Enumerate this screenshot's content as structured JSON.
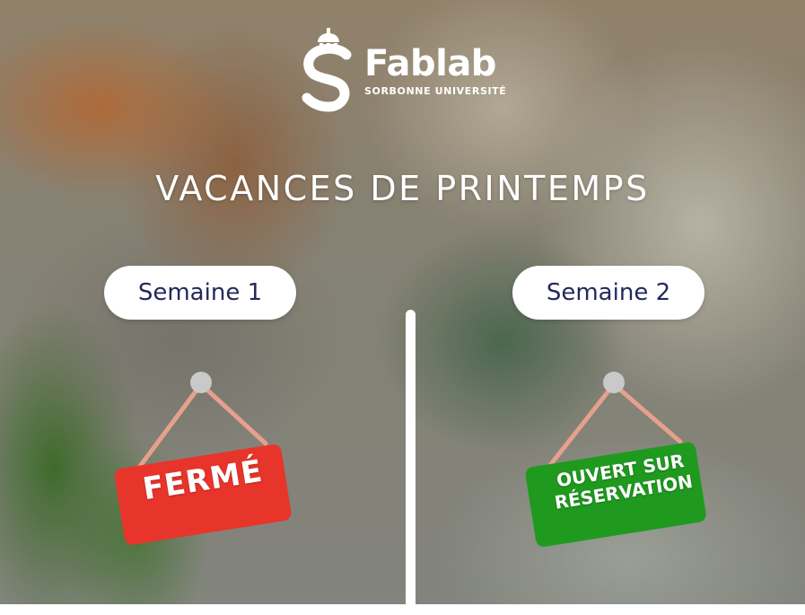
{
  "brand": {
    "name": "Fablab",
    "subtitle": "SORBONNE UNIVERSITÉ"
  },
  "headline": "VACANCES DE PRINTEMPS",
  "weeks": [
    {
      "label": "Semaine 1",
      "sign_line1": "FERMÉ",
      "sign_line2": "",
      "sign_color": "#e8352b"
    },
    {
      "label": "Semaine 2",
      "sign_line1": "OUVERT SUR",
      "sign_line2": "RÉSERVATION",
      "sign_color": "#1f9a1f"
    }
  ],
  "colors": {
    "pill_text": "#23295a",
    "closed": "#e8352b",
    "open": "#1f9a1f",
    "rope": "#e6a08c",
    "nail": "#c9c9c9"
  }
}
